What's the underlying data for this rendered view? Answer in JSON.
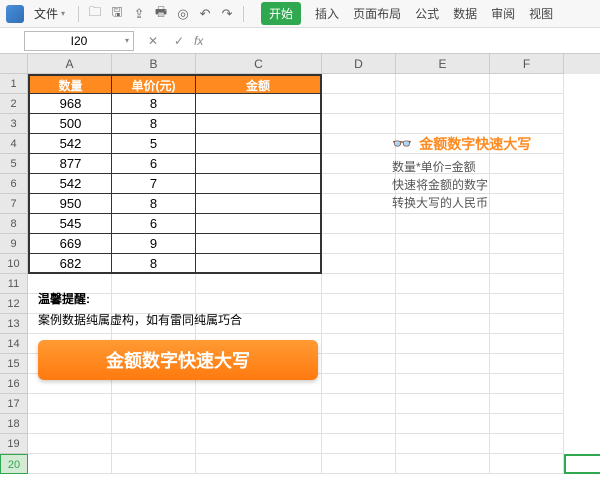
{
  "menu": {
    "file": "文件"
  },
  "tabs": [
    "开始",
    "插入",
    "页面布局",
    "公式",
    "数据",
    "审阅",
    "视图"
  ],
  "activeTab": 0,
  "nameBox": "I20",
  "fx": "fx",
  "columns": [
    "A",
    "B",
    "C",
    "D",
    "E",
    "F"
  ],
  "rowCount": 20,
  "selectedRow": 20,
  "table": {
    "headers": [
      "数量",
      "单价(元)",
      "金额"
    ],
    "rows": [
      [
        "968",
        "8",
        ""
      ],
      [
        "500",
        "8",
        ""
      ],
      [
        "542",
        "5",
        ""
      ],
      [
        "877",
        "6",
        ""
      ],
      [
        "542",
        "7",
        ""
      ],
      [
        "950",
        "8",
        ""
      ],
      [
        "545",
        "6",
        ""
      ],
      [
        "669",
        "9",
        ""
      ],
      [
        "682",
        "8",
        ""
      ]
    ]
  },
  "tip": {
    "title": "温馨提醒:",
    "body": "案例数据纯属虚构，如有雷同纯属巧合"
  },
  "bigButton": "金额数字快速大写",
  "callout": {
    "icon": "👓",
    "title": "金额数字快速大写",
    "lines": [
      "数量*单价=金额",
      "快速将金额的数字",
      "转换大写的人民币"
    ]
  },
  "chart_data": {
    "type": "table",
    "title": "金额数字快速大写",
    "columns": [
      "数量",
      "单价(元)",
      "金额"
    ],
    "rows": [
      [
        968,
        8,
        null
      ],
      [
        500,
        8,
        null
      ],
      [
        542,
        5,
        null
      ],
      [
        877,
        6,
        null
      ],
      [
        542,
        7,
        null
      ],
      [
        950,
        8,
        null
      ],
      [
        545,
        6,
        null
      ],
      [
        669,
        9,
        null
      ],
      [
        682,
        8,
        null
      ]
    ]
  }
}
